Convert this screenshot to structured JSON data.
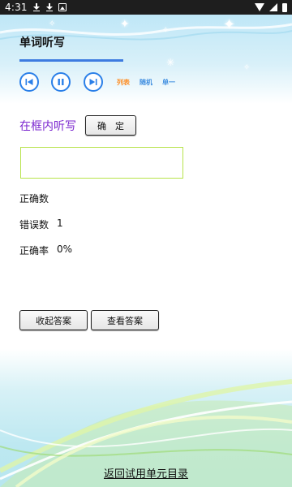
{
  "status_bar": {
    "time": "4:31",
    "left_icons": [
      "download-icon",
      "download-icon",
      "image-icon"
    ],
    "right_icons": [
      "wifi-icon",
      "signal-icon",
      "battery-icon"
    ]
  },
  "header": {
    "title": "单词听写",
    "progress": 1.0
  },
  "controls": {
    "prev_icon": "skip-previous-icon",
    "pause_icon": "pause-icon",
    "next_icon": "skip-next-icon",
    "list_label": "列表",
    "random_label": "随机",
    "single_label": "单一",
    "list_color": "#ff8a1c",
    "random_color": "#3f8ee0",
    "single_color": "#3f8ee0"
  },
  "dictation": {
    "prompt": "在框内听写",
    "confirm_label": "确　定",
    "input_value": ""
  },
  "stats": {
    "correct_label": "正确数",
    "correct_value": "",
    "wrong_label": "错误数",
    "wrong_value": "1",
    "rate_label": "正确率",
    "rate_value": "0%"
  },
  "actions": {
    "collapse_label": "收起答案",
    "view_label": "查看答案"
  },
  "footer": {
    "back_link": "返回试用单元目录"
  },
  "colors": {
    "accent": "#2a7fe8",
    "prompt": "#7b26cf",
    "input_border": "#b7e34a"
  }
}
